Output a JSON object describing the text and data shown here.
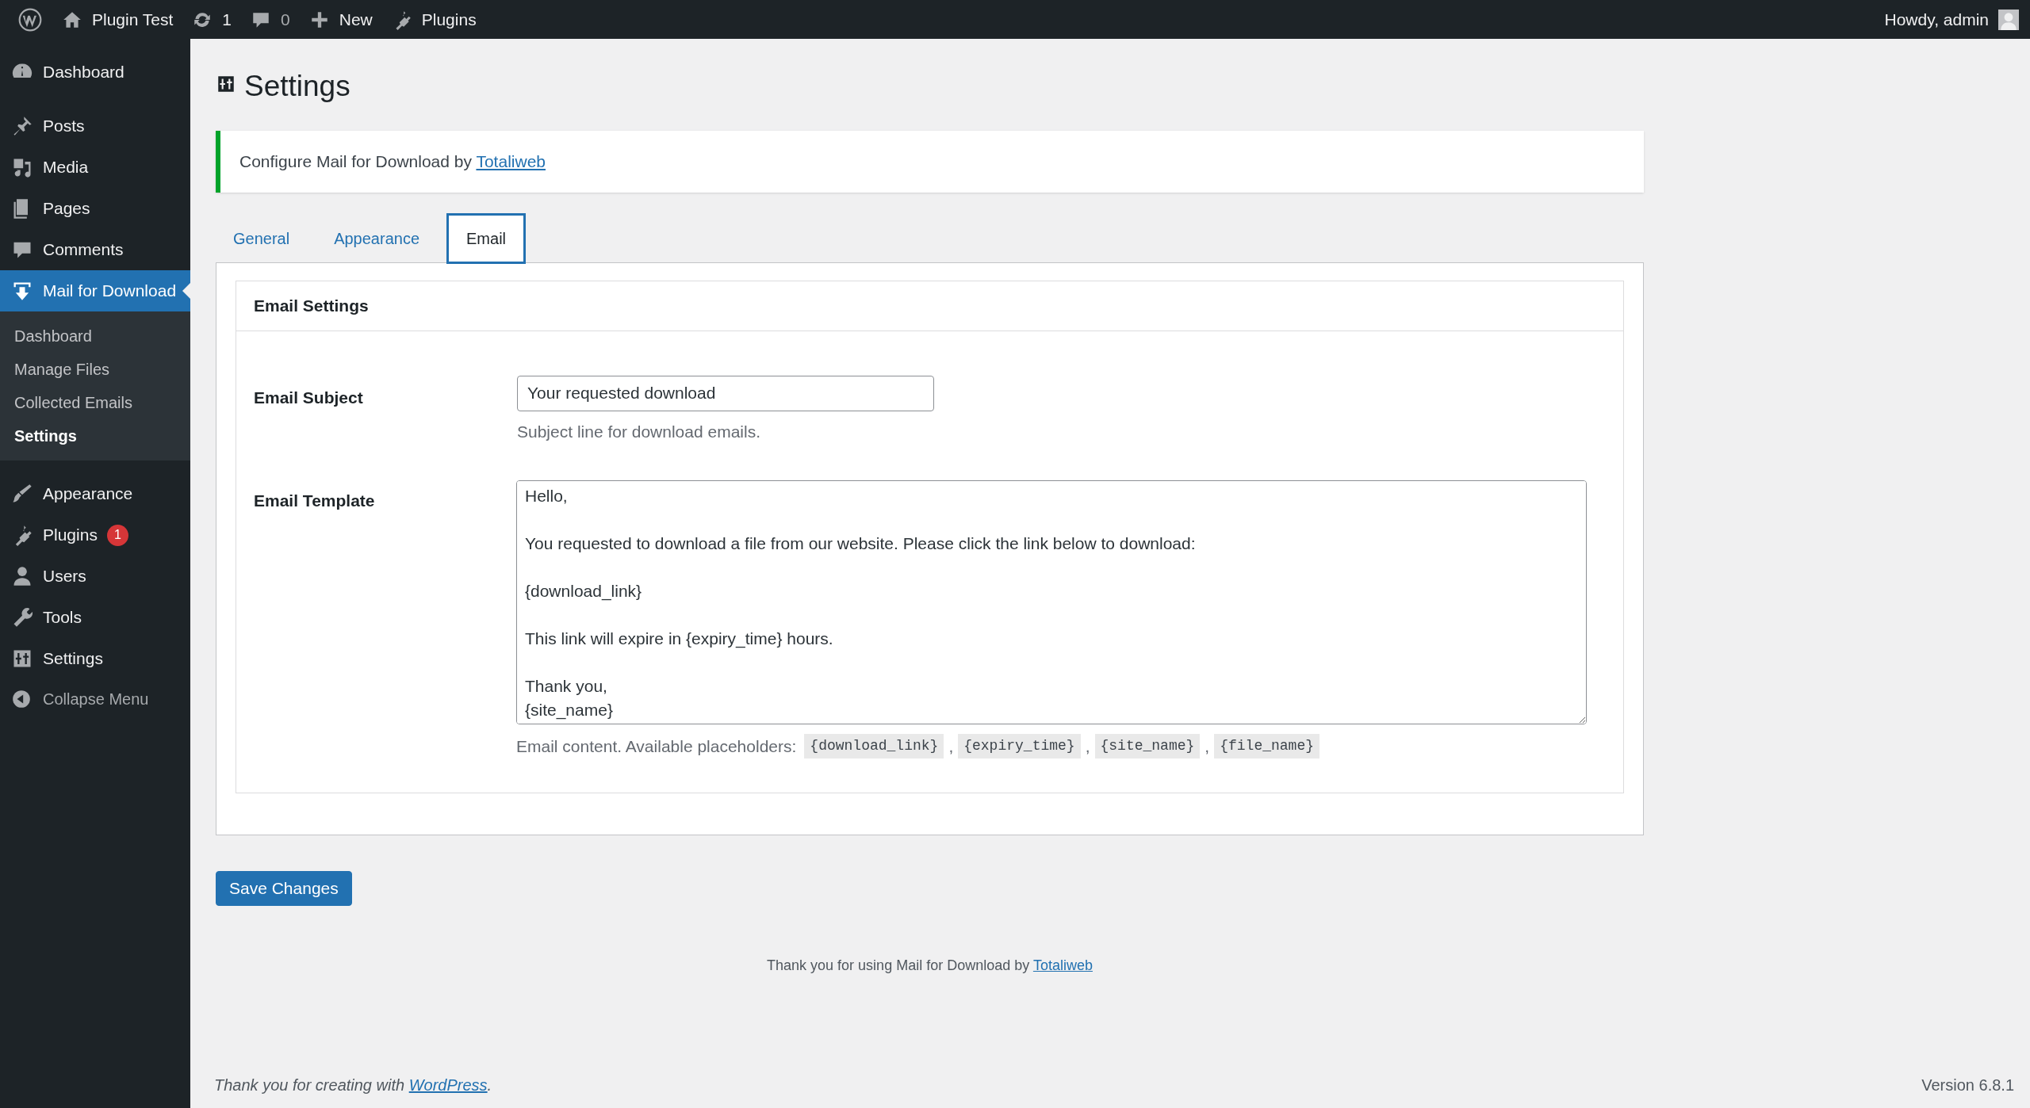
{
  "admin_bar": {
    "items": [
      {
        "kind": "wp-logo"
      },
      {
        "kind": "site",
        "label": "Plugin Test"
      },
      {
        "kind": "updates",
        "label": "1"
      },
      {
        "kind": "comments",
        "label": "0"
      },
      {
        "kind": "new",
        "label": "New"
      },
      {
        "kind": "plugins",
        "label": "Plugins"
      }
    ],
    "greeting": "Howdy, admin"
  },
  "sidebar": {
    "items": [
      {
        "kind": "dashboard",
        "label": "Dashboard",
        "selected": false
      },
      {
        "kind": "posts",
        "label": "Posts",
        "selected": false
      },
      {
        "kind": "media",
        "label": "Media",
        "selected": false
      },
      {
        "kind": "pages",
        "label": "Pages",
        "selected": false
      },
      {
        "kind": "comments",
        "label": "Comments",
        "selected": false
      },
      {
        "kind": "download",
        "label": "Mail for Download",
        "selected": true,
        "children": [
          {
            "label": "Dashboard",
            "selected": false
          },
          {
            "label": "Manage Files",
            "selected": false
          },
          {
            "label": "Collected Emails",
            "selected": false
          },
          {
            "label": "Settings",
            "selected": true
          }
        ]
      },
      {
        "kind": "appearance",
        "label": "Appearance",
        "selected": false
      },
      {
        "kind": "plugins",
        "label": "Plugins",
        "selected": false,
        "badge": "1"
      },
      {
        "kind": "users",
        "label": "Users",
        "selected": false
      },
      {
        "kind": "tools",
        "label": "Tools",
        "selected": false
      },
      {
        "kind": "settings",
        "label": "Settings",
        "selected": false
      }
    ],
    "collapse": "Collapse Menu"
  },
  "page_title": "Settings",
  "notice": {
    "text": "Configure Mail for Download by",
    "link": "Totaliweb"
  },
  "tabs": [
    {
      "label": "General",
      "selected": false
    },
    {
      "label": "Appearance",
      "selected": false
    },
    {
      "label": "Email",
      "selected": true
    }
  ],
  "section": {
    "title": "Email Settings",
    "subject": {
      "label": "Email Subject",
      "value": "Your requested download",
      "description": "Subject line for download emails."
    },
    "template": {
      "label": "Email Template",
      "value": "Hello,\n\nYou requested to download a file from our website. Please click the link below to download:\n\n{download_link}\n\nThis link will expire in {expiry_time} hours.\n\nThank you,\n{site_name}",
      "description": "Email content. Available placeholders:",
      "placeholders": [
        "{download_link}",
        "{expiry_time}",
        "{site_name}",
        "{file_name}"
      ],
      "separator": ","
    }
  },
  "save_button": "Save Changes",
  "plugin_footer": {
    "text": "Thank you for using Mail for Download by",
    "link": "Totaliweb"
  },
  "footer": {
    "text": "Thank you for creating with",
    "link": "WordPress",
    "end": ".",
    "version": "Version 6.8.1"
  }
}
